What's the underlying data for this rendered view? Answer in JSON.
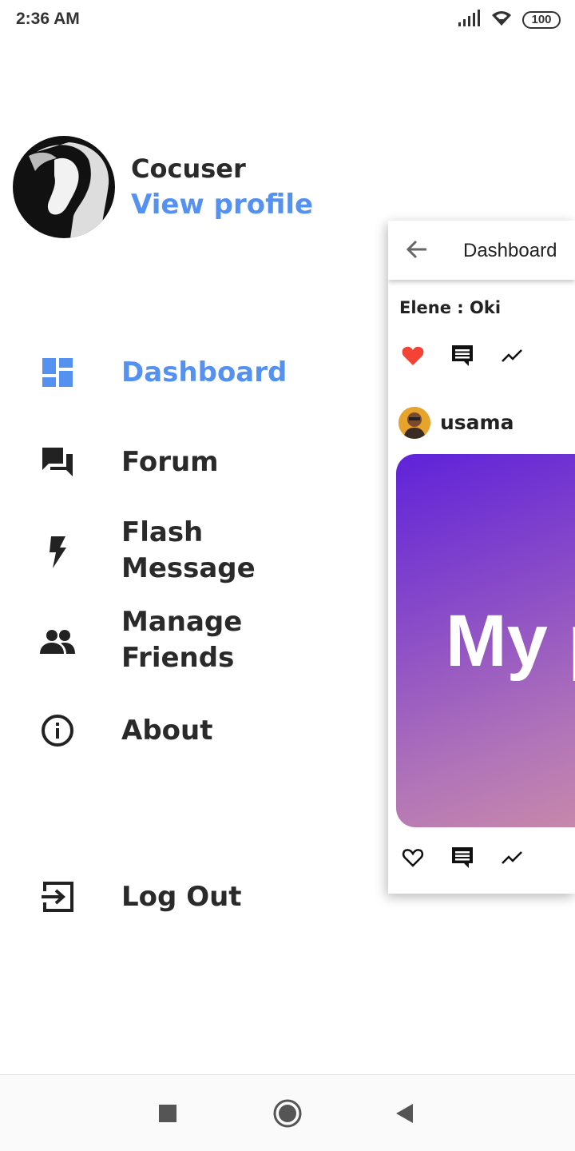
{
  "status_bar": {
    "time": "2:36 AM",
    "battery": "100",
    "icons": [
      "signal-icon",
      "wifi-icon",
      "battery-icon"
    ]
  },
  "drawer": {
    "profile": {
      "name": "Cocuser",
      "link_label": "View profile"
    },
    "menu": [
      {
        "label": "Dashboard",
        "icon": "dashboard-icon",
        "active": true
      },
      {
        "label": "Forum",
        "icon": "forum-icon",
        "active": false
      },
      {
        "label": "Flash Message",
        "icon": "flash-icon",
        "active": false
      },
      {
        "label": "Manage Friends",
        "icon": "people-icon",
        "active": false
      },
      {
        "label": "About",
        "icon": "info-icon",
        "active": false
      },
      {
        "label": "Log Out",
        "icon": "logout-icon",
        "active": false
      }
    ],
    "colors": {
      "accent": "#5591f0",
      "text": "#2a2a2a"
    }
  },
  "preview": {
    "title": "Dashboard",
    "comment": "Elene : Oki",
    "post": {
      "username": "usama",
      "image_text": "My p",
      "gradient": [
        "#5f22d9",
        "#c98aa9"
      ]
    },
    "like_color": "#f44336"
  },
  "nav_bar": {
    "buttons": [
      "recents-button",
      "home-button",
      "back-button"
    ]
  }
}
